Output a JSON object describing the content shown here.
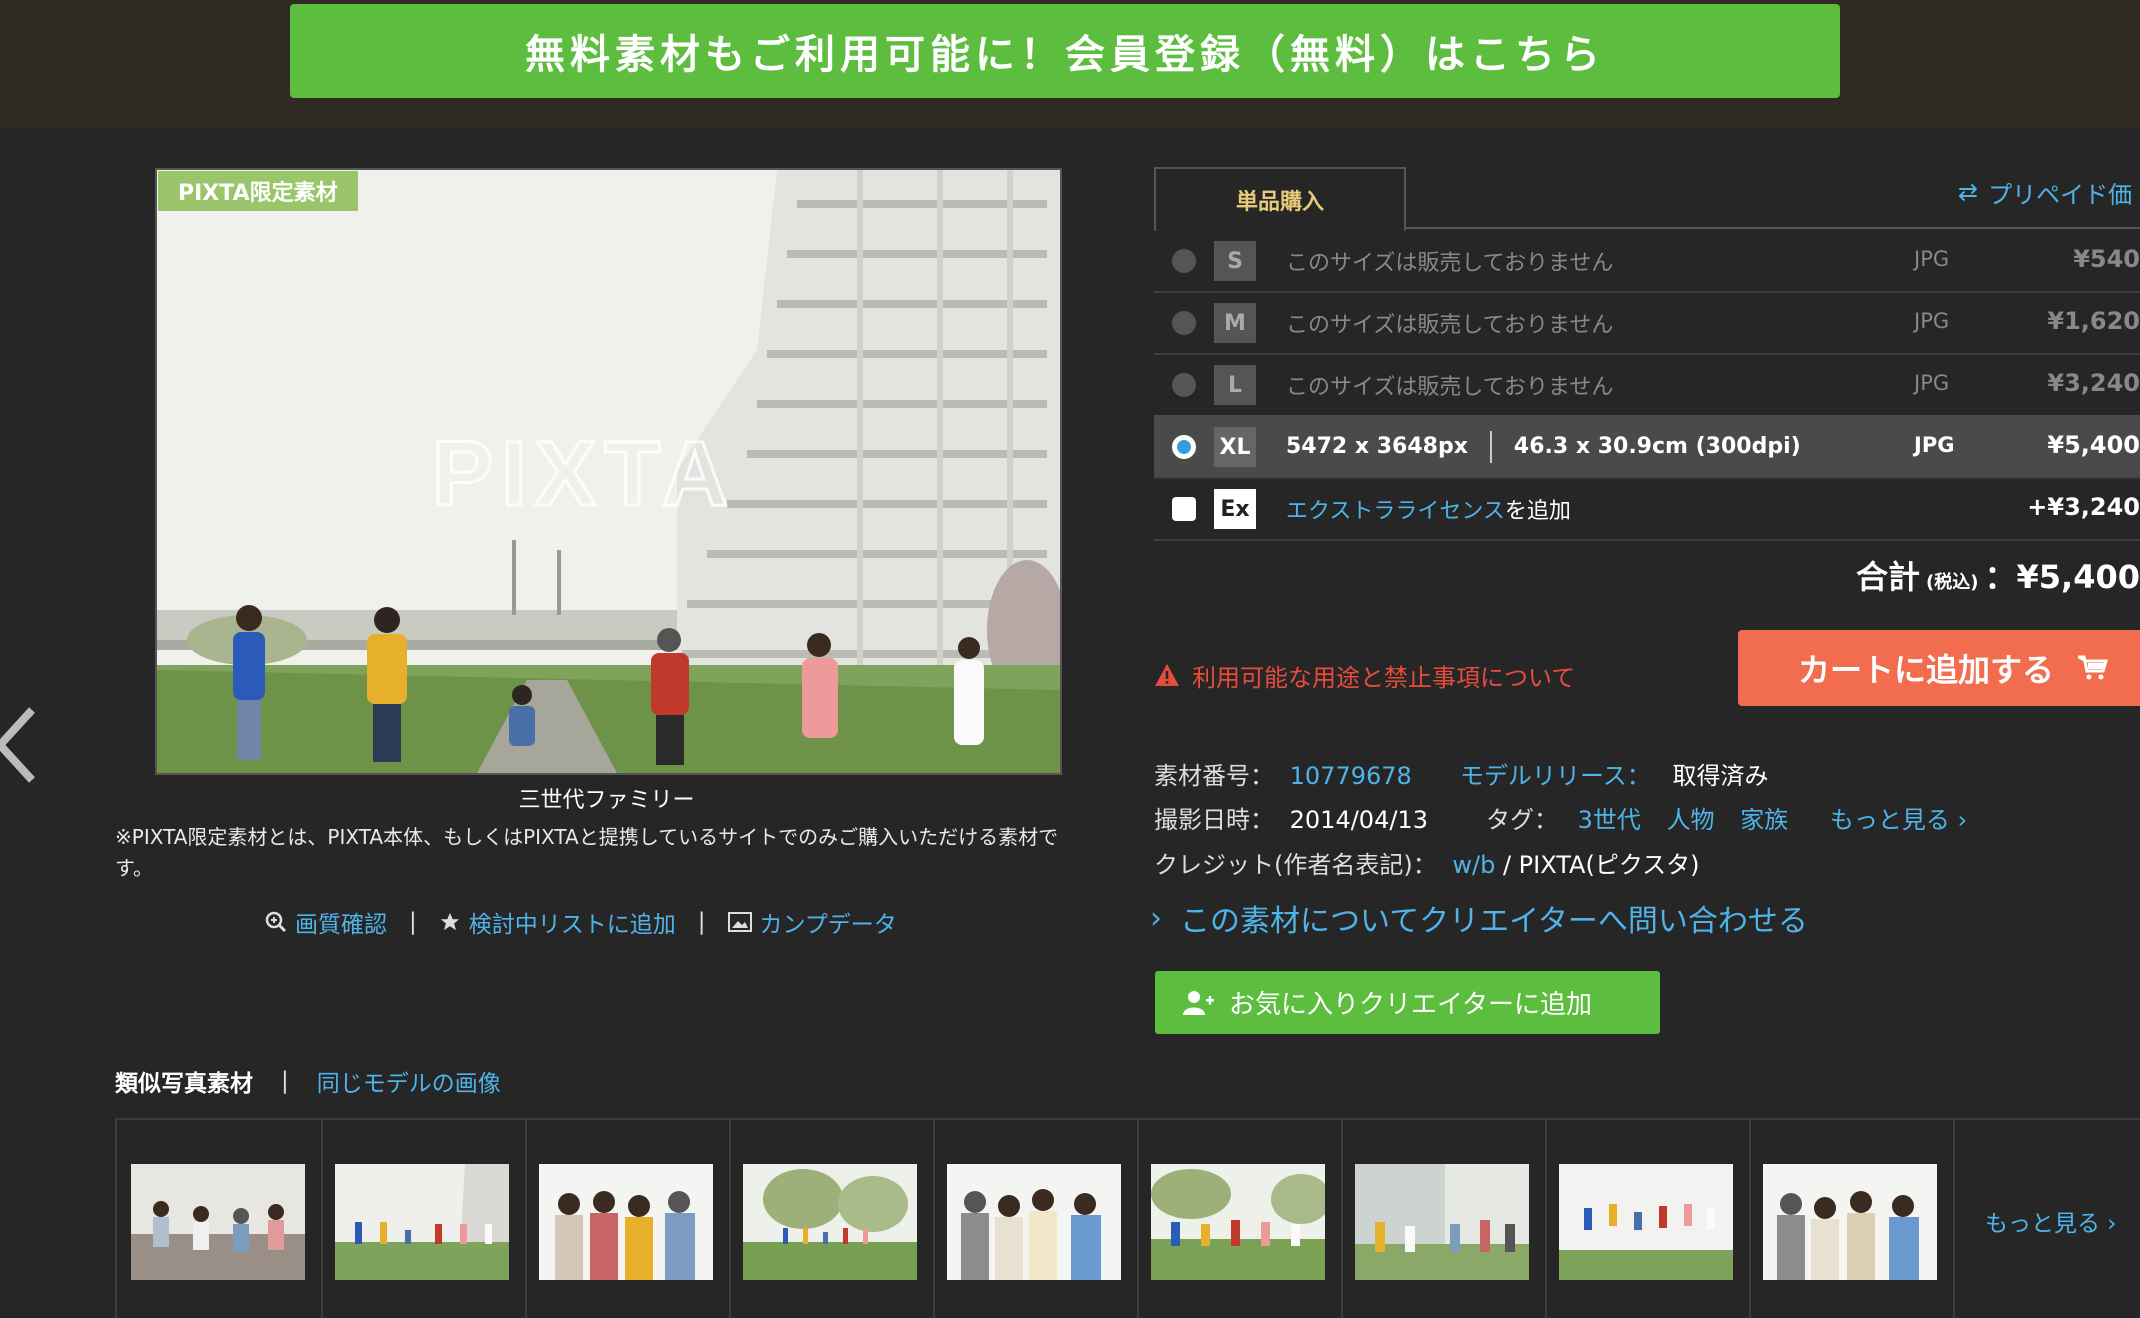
{
  "banner": {
    "text": "無料素材もご利用可能に！会員登録（無料）はこちら"
  },
  "photo": {
    "tag": "PIXTA限定素材",
    "watermark": "PIXTA",
    "caption": "三世代ファミリー",
    "note": "※PIXTA限定素材とは、PIXTA本体、もしくはPIXTAと提携しているサイトでのみご購入いただける素材です。",
    "actions": [
      "画質確認",
      "検討中リストに追加",
      "カンプデータ"
    ]
  },
  "purchase": {
    "tab": "単品購入",
    "prepaid": "プリペイド価",
    "sizes": [
      {
        "badge": "S",
        "text": "このサイズは販売しておりません",
        "format": "JPG",
        "price": "¥540"
      },
      {
        "badge": "M",
        "text": "このサイズは販売しておりません",
        "format": "JPG",
        "price": "¥1,620"
      },
      {
        "badge": "L",
        "text": "このサイズは販売しておりません",
        "format": "JPG",
        "price": "¥3,240"
      },
      {
        "badge": "XL",
        "pixels": "5472 x 3648px",
        "cm": "46.3 x 30.9cm (300dpi)",
        "format": "JPG",
        "price": "¥5,400"
      }
    ],
    "extra": {
      "badge": "Ex",
      "link": "エクストラライセンス",
      "tail": "を追加",
      "price": "+¥3,240"
    },
    "total": {
      "label": "合計",
      "tax": "(税込)",
      "sep": "：",
      "value": "¥5,400"
    },
    "warning": "利用可能な用途と禁止事項について",
    "cart": "カートに追加する"
  },
  "meta": {
    "id_label": "素材番号：",
    "id_value": "10779678",
    "release_label": "モデルリリース：",
    "release_value": "取得済み",
    "date_label": "撮影日時：",
    "date_value": "2014/04/13",
    "tags_label": "タグ：",
    "tags": [
      "3世代",
      "人物",
      "家族"
    ],
    "tags_more": "もっと見る ›",
    "credit_label": "クレジット(作者名表記)：",
    "credit_author": "w/b",
    "credit_sep": " / ",
    "credit_site": "PIXTA(ピクスタ)",
    "contact": "この素材についてクリエイターへ問い合わせる",
    "favorite": "お気に入りクリエイターに追加"
  },
  "similar": {
    "title": "類似写真素材",
    "same_model": "同じモデルの画像",
    "more": "もっと見る ›"
  },
  "colors": {
    "green": "#5cbd3e",
    "orange": "#f26c4f",
    "link": "#4fb3ea",
    "warning": "#e64c3c"
  }
}
